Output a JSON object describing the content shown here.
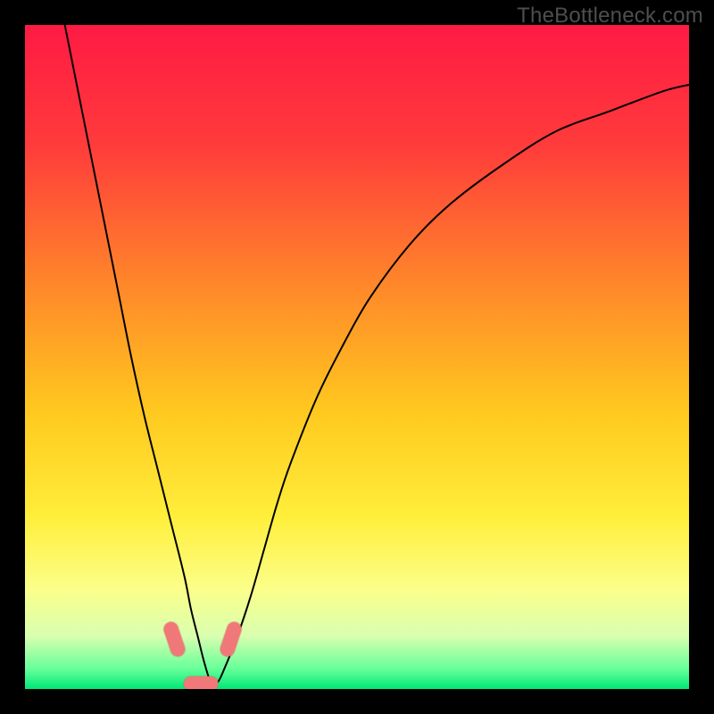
{
  "watermark": "TheBottleneck.com",
  "colors": {
    "bg": "#000000",
    "gradient_stops": [
      {
        "pct": 0,
        "color": "#ff1a44"
      },
      {
        "pct": 18,
        "color": "#ff3b3b"
      },
      {
        "pct": 40,
        "color": "#ff8a29"
      },
      {
        "pct": 58,
        "color": "#ffc81f"
      },
      {
        "pct": 74,
        "color": "#ffee3a"
      },
      {
        "pct": 85,
        "color": "#fbff8a"
      },
      {
        "pct": 92,
        "color": "#d9ffb0"
      },
      {
        "pct": 97,
        "color": "#66ff99"
      },
      {
        "pct": 100,
        "color": "#00e878"
      }
    ],
    "curve": "#000000",
    "marker_fill": "#f07878",
    "marker_stroke": "#d85c5c"
  },
  "chart_data": {
    "type": "line",
    "title": "",
    "xlabel": "",
    "ylabel": "",
    "xlim": [
      0,
      100
    ],
    "ylim": [
      0,
      100
    ],
    "series": [
      {
        "name": "bottleneck-curve",
        "x": [
          6,
          8,
          10,
          12,
          14,
          16,
          18,
          20,
          22,
          24,
          25,
          26,
          27,
          28,
          29,
          30,
          32,
          34,
          36,
          38,
          40,
          44,
          48,
          52,
          58,
          64,
          72,
          80,
          88,
          96,
          100
        ],
        "y": [
          100,
          90,
          80,
          70,
          60,
          50,
          41,
          33,
          25,
          17,
          12,
          8,
          4,
          1,
          1,
          3,
          8,
          14,
          21,
          28,
          34,
          44,
          52,
          59,
          67,
          73,
          79,
          84,
          87,
          90,
          91
        ]
      }
    ],
    "markers": [
      {
        "name": "left-pill",
        "x0": 22.0,
        "y0": 9.0,
        "x1": 23.0,
        "y1": 6.0
      },
      {
        "name": "floor-pill",
        "x0": 25.0,
        "y0": 0.8,
        "x1": 28.0,
        "y1": 0.8
      },
      {
        "name": "right-pill",
        "x0": 30.5,
        "y0": 6.0,
        "x1": 31.5,
        "y1": 9.0
      }
    ]
  }
}
